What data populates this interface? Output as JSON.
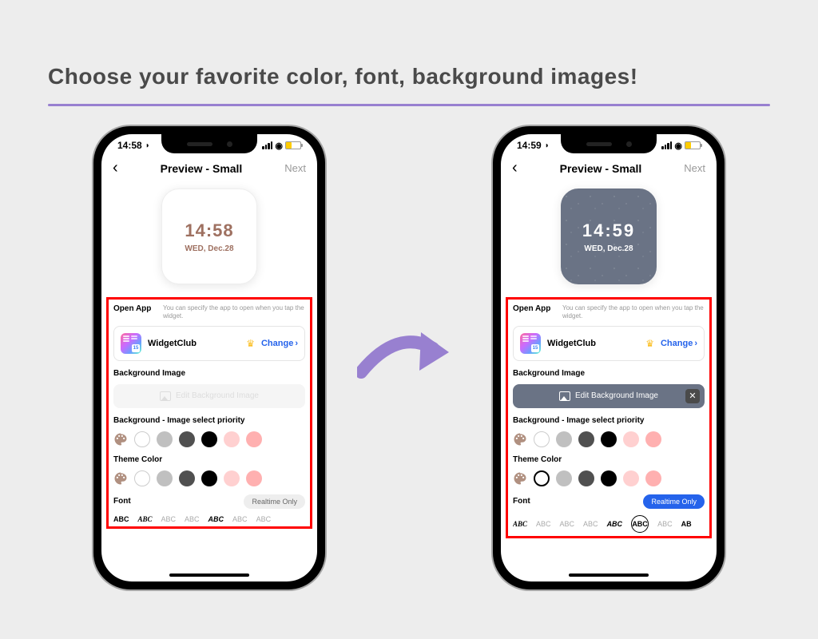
{
  "heading": "Choose your favorite color, font, background images!",
  "phone_left": {
    "time": "14:58",
    "nav_title": "Preview - Small",
    "nav_next": "Next",
    "widget_time": "14:58",
    "widget_date": "WED, Dec.28",
    "open_app_label": "Open App",
    "open_app_desc": "You can specify the app to open when you tap the widget.",
    "app_name": "WidgetClub",
    "change": "Change",
    "bg_image_title": "Background Image",
    "edit_bg": "Edit Background Image",
    "bg_priority_title": "Background - Image select priority",
    "theme_color_title": "Theme Color",
    "font_title": "Font",
    "realtime": "Realtime Only",
    "fonts": [
      "ABC",
      "ABC",
      "ABC",
      "ABC",
      "ABC",
      "ABC",
      "ABC"
    ]
  },
  "phone_right": {
    "time": "14:59",
    "nav_title": "Preview - Small",
    "nav_next": "Next",
    "widget_time": "14:59",
    "widget_date": "WED, Dec.28",
    "open_app_label": "Open App",
    "open_app_desc": "You can specify the app to open when you tap the widget.",
    "app_name": "WidgetClub",
    "change": "Change",
    "bg_image_title": "Background Image",
    "edit_bg": "Edit Background Image",
    "bg_priority_title": "Background - Image select priority",
    "theme_color_title": "Theme Color",
    "font_title": "Font",
    "realtime": "Realtime Only",
    "fonts": [
      "ABC",
      "ABC",
      "ABC",
      "ABC",
      "ABC",
      "ABC",
      "ABC",
      "AB"
    ]
  }
}
